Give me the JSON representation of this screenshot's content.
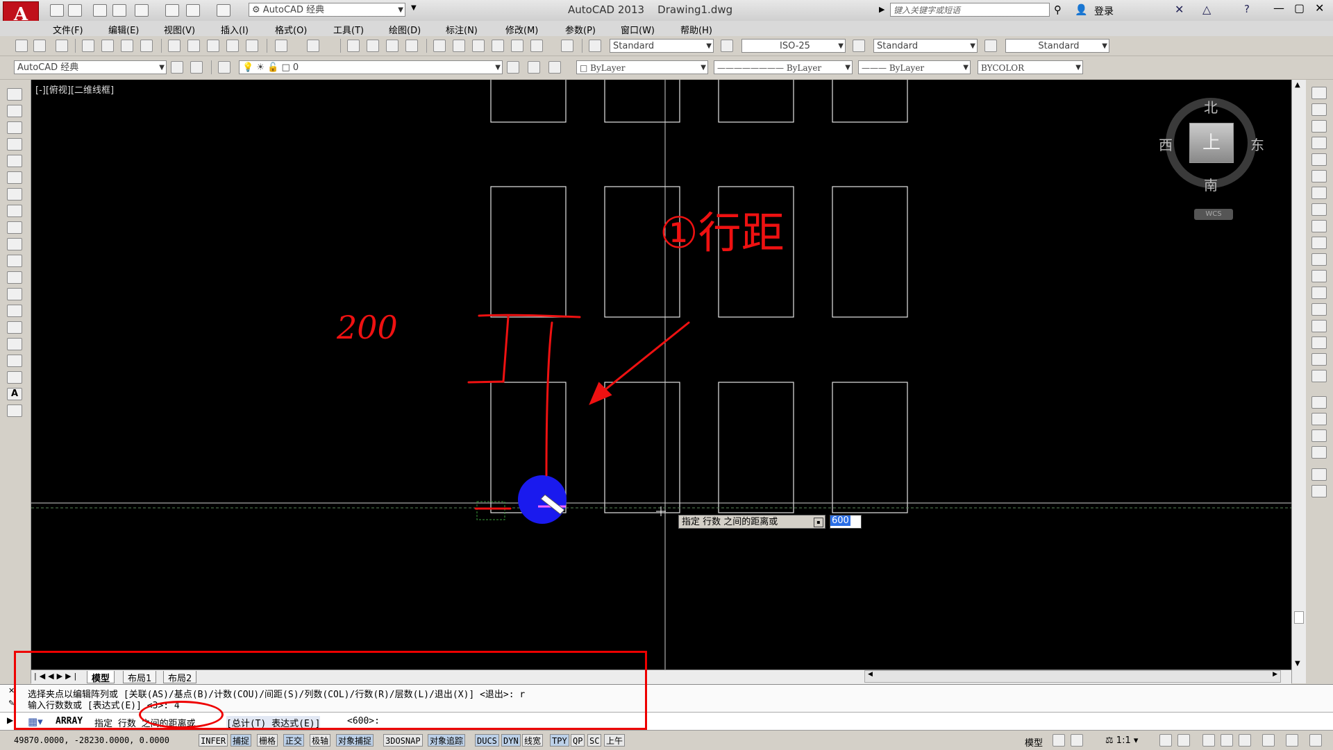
{
  "title": {
    "workspace": "AutoCAD 经典",
    "app": "AutoCAD 2013",
    "document": "Drawing1.dwg",
    "search_placeholder": "键入关键字或短语",
    "login": "登录"
  },
  "menu": [
    "文件(F)",
    "编辑(E)",
    "视图(V)",
    "插入(I)",
    "格式(O)",
    "工具(T)",
    "绘图(D)",
    "标注(N)",
    "修改(M)",
    "参数(P)",
    "窗口(W)",
    "帮助(H)"
  ],
  "styles": {
    "text_style": "Standard",
    "dim_style": "ISO-25",
    "table_style": "Standard",
    "mleader_style": "Standard"
  },
  "layers": {
    "workspace": "AutoCAD 经典",
    "layer": "0",
    "color": "ByLayer",
    "linetype": "ByLayer",
    "lineweight": "ByLayer",
    "plotstyle": "BYCOLOR"
  },
  "viewport": {
    "label": "[-][俯视][二维线框]"
  },
  "viewcube": {
    "north": "北",
    "south": "南",
    "west": "西",
    "east": "东",
    "top": "上",
    "wcs": "WCS"
  },
  "annotation": {
    "title": "①行距",
    "handwritten": "200"
  },
  "tooltip": {
    "prompt": "指定 行数 之间的距离或",
    "input_value": "600"
  },
  "tabs": [
    "模型",
    "布局1",
    "布局2"
  ],
  "command": {
    "line1": "选择夹点以编辑阵列或 [关联(AS)/基点(B)/计数(COU)/间距(S)/列数(COL)/行数(R)/层数(L)/退出(X)] <退出>: r",
    "line2": "输入行数数或 [表达式(E)] <3>: 4",
    "cmd_name": "ARRAY",
    "prompt": "指定 行数 之间的距离或",
    "options": "[总计(T) 表达式(E)]",
    "default": "<600>:"
  },
  "status": {
    "coords": "49870.0000, -28230.0000, 0.0000",
    "toggles": [
      "INFER",
      "捕捉",
      "栅格",
      "正交",
      "极轴",
      "对象捕捉",
      "3DOSNAP",
      "对象追踪",
      "DUCS",
      "DYN",
      "线宽",
      "TPY",
      "QP",
      "SC",
      "上午"
    ],
    "model": "模型",
    "scale": "1:1"
  },
  "colors": {
    "canvas": "#000000",
    "annotation_red": "#ee1111",
    "grip_blue": "#1a1aee"
  }
}
